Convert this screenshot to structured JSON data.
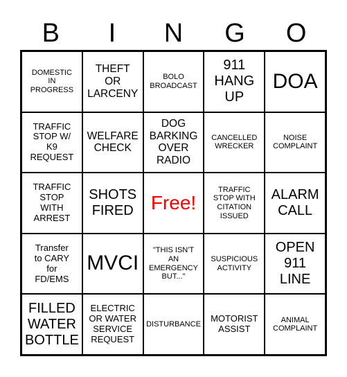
{
  "header": {
    "letters": [
      "B",
      "I",
      "N",
      "G",
      "O"
    ]
  },
  "grid": {
    "cells": [
      {
        "text": "DOMESTIC\nIN\nPROGRESS",
        "size": "s-xs"
      },
      {
        "text": "THEFT\nOR\nLARCENY",
        "size": "s-md"
      },
      {
        "text": "BOLO\nBROADCAST",
        "size": "s-xs"
      },
      {
        "text": "911\nHANG\nUP",
        "size": "s-lg"
      },
      {
        "text": "DOA",
        "size": "s-xl"
      },
      {
        "text": "TRAFFIC\nSTOP W/\nK9\nREQUEST",
        "size": "s-sm"
      },
      {
        "text": "WELFARE\nCHECK",
        "size": "s-md"
      },
      {
        "text": "DOG\nBARKING\nOVER\nRADIO",
        "size": "s-md"
      },
      {
        "text": "CANCELLED\nWRECKER",
        "size": "s-xs"
      },
      {
        "text": "NOISE\nCOMPLAINT",
        "size": "s-xs"
      },
      {
        "text": "TRAFFIC\nSTOP\nWITH\nARREST",
        "size": "s-sm"
      },
      {
        "text": "SHOTS\nFIRED",
        "size": "s-lg"
      },
      {
        "text": "Free!",
        "size": "free"
      },
      {
        "text": "TRAFFIC\nSTOP WITH\nCITATION\nISSUED",
        "size": "s-xs"
      },
      {
        "text": "ALARM\nCALL",
        "size": "s-lg"
      },
      {
        "text": "Transfer\nto CARY\nfor\nFD/EMS",
        "size": "s-sm"
      },
      {
        "text": "MVCI",
        "size": "s-xl"
      },
      {
        "text": "\"THIS ISN'T\nAN\nEMERGENCY\nBUT...\"",
        "size": "s-xs"
      },
      {
        "text": "SUSPICIOUS\nACTIVITY",
        "size": "s-xs"
      },
      {
        "text": "OPEN\n911\nLINE",
        "size": "s-lg"
      },
      {
        "text": "FILLED\nWATER\nBOTTLE",
        "size": "s-lg"
      },
      {
        "text": "ELECTRIC\nOR WATER\nSERVICE\nREQUEST",
        "size": "s-sm"
      },
      {
        "text": "DISTURBANCE",
        "size": "s-xs"
      },
      {
        "text": "MOTORIST\nASSIST",
        "size": "s-sm"
      },
      {
        "text": "ANIMAL\nCOMPLAINT",
        "size": "s-xs"
      }
    ]
  },
  "colors": {
    "free_space": "#ff0000",
    "grid_line": "#000000",
    "background": "#ffffff"
  }
}
